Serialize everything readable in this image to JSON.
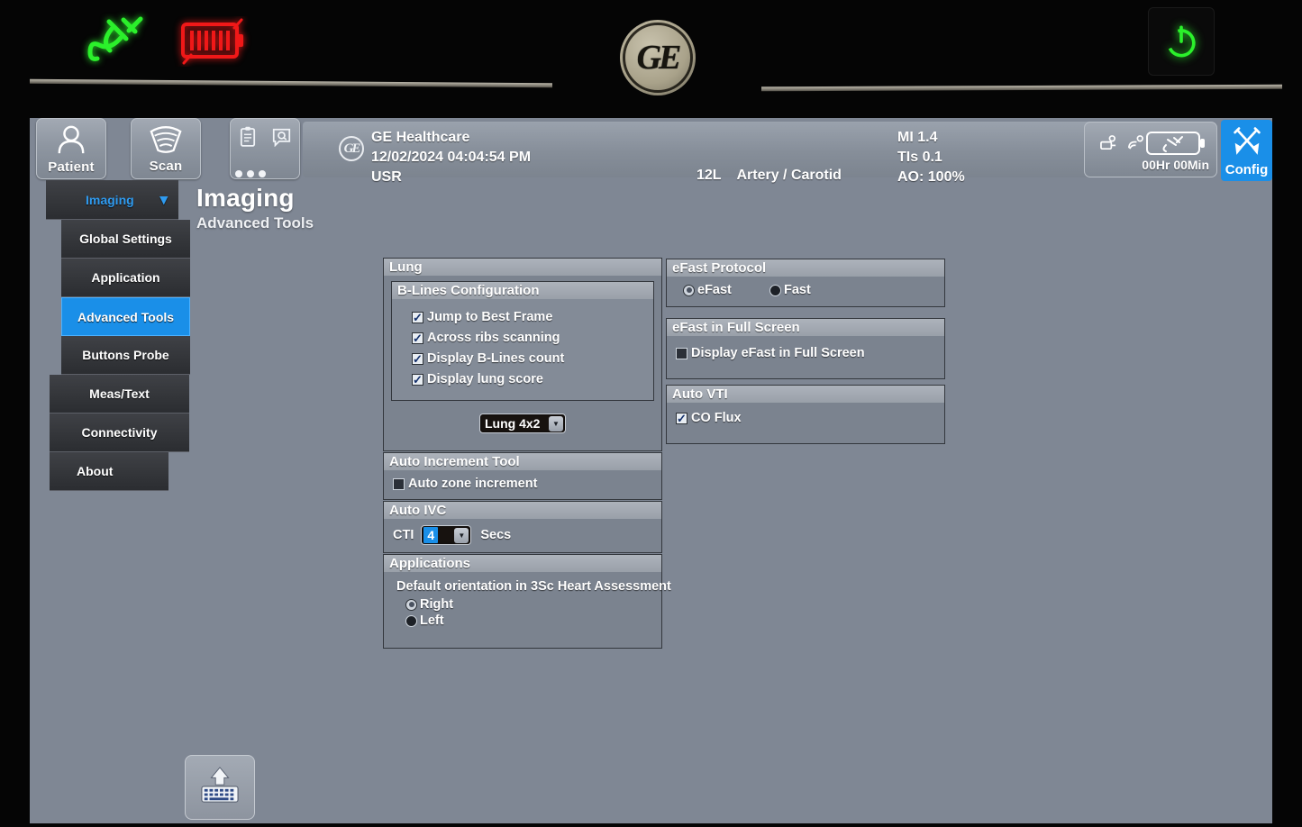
{
  "device": {
    "bezel": {
      "plug_indicator": "plug-connected",
      "battery_indicator": "battery-charging",
      "power_button": "power",
      "brand_logo": "GE"
    }
  },
  "topbar": {
    "patient_label": "Patient",
    "scan_label": "Scan",
    "tools_icons": [
      "clipboard-icon",
      "search-icon",
      "more-dots-icon"
    ],
    "ge_mark": "GE",
    "manufacturer": "GE Healthcare",
    "datetime": "12/02/2024 04:04:54 PM",
    "user": "USR",
    "probe": "12L",
    "application": "Artery / Carotid",
    "mi": "MI 1.4",
    "tis": "TIs 0.1",
    "ao": "AO: 100%",
    "battery_time": "00Hr 00Min",
    "config_label": "Config"
  },
  "page": {
    "title": "Imaging",
    "subtitle": "Advanced Tools"
  },
  "sidebar": {
    "group_label": "Imaging",
    "chevron": "⌄",
    "items": [
      {
        "label": "Global Settings",
        "type": "sub",
        "active": false
      },
      {
        "label": "Application",
        "type": "sub",
        "active": false
      },
      {
        "label": "Advanced Tools",
        "type": "sub",
        "active": true
      },
      {
        "label": "Buttons Probe",
        "type": "sub",
        "active": false
      },
      {
        "label": "Meas/Text",
        "type": "lone",
        "active": false
      },
      {
        "label": "Connectivity",
        "type": "lone",
        "active": false
      },
      {
        "label": "About",
        "type": "lone",
        "active": false
      }
    ]
  },
  "panels": {
    "lung": {
      "title": "Lung",
      "blines": {
        "title": "B-Lines Configuration",
        "options": [
          {
            "label": "Jump to Best Frame",
            "checked": true
          },
          {
            "label": "Across ribs scanning",
            "checked": true
          },
          {
            "label": "Display B-Lines count",
            "checked": true
          },
          {
            "label": "Display lung score",
            "checked": true
          }
        ]
      },
      "layout_select": {
        "value": "Lung 4x2",
        "options": [
          "Lung 4x2"
        ]
      }
    },
    "auto_increment": {
      "title": "Auto Increment Tool",
      "options": [
        {
          "label": "Auto zone increment",
          "checked": false
        }
      ]
    },
    "auto_ivc": {
      "title": "Auto IVC",
      "field_label": "CTI",
      "value": "4",
      "unit": "Secs"
    },
    "applications": {
      "title": "Applications",
      "description": "Default orientation in 3Sc Heart Assessment",
      "radios": [
        {
          "label": "Right",
          "selected": true
        },
        {
          "label": "Left",
          "selected": false
        }
      ]
    },
    "efast_protocol": {
      "title": "eFast Protocol",
      "radios": [
        {
          "label": "eFast",
          "selected": true
        },
        {
          "label": "Fast",
          "selected": false
        }
      ]
    },
    "efast_fullscreen": {
      "title": "eFast in Full Screen",
      "options": [
        {
          "label": "Display eFast in Full Screen",
          "checked": false
        }
      ]
    },
    "auto_vti": {
      "title": "Auto VTI",
      "options": [
        {
          "label": "CO Flux",
          "checked": true
        }
      ]
    }
  },
  "footer": {
    "keyboard_button": "keyboard-up-icon"
  },
  "colors": {
    "accent_blue": "#1a8fe8",
    "screen_bg": "#7f8794",
    "panel_bg": "#7b838f",
    "panel_header": "#a3aab3",
    "sidebar_item": "#35373c",
    "led_green": "#2bf02b",
    "led_red": "#f01818"
  }
}
